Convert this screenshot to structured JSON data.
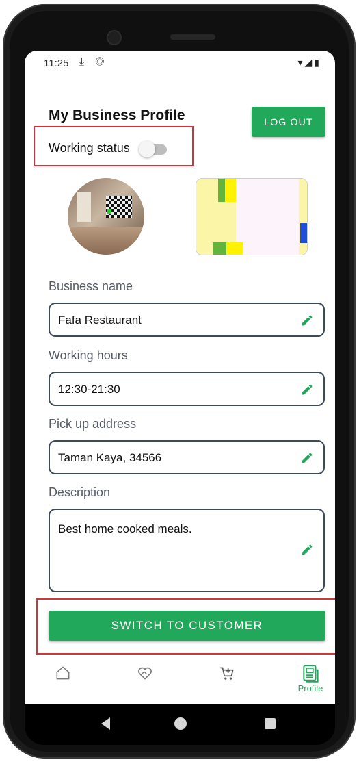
{
  "status_bar": {
    "time": "11:25",
    "left_icons": "⤓ ◎",
    "right_icons": "▾◢▮"
  },
  "header": {
    "title": "My Business Profile",
    "logout_label": "LOG OUT"
  },
  "working_status": {
    "label": "Working status",
    "on": false
  },
  "fields": [
    {
      "label": "Business name",
      "value": "Fafa Restaurant"
    },
    {
      "label": "Working hours",
      "value": "12:30-21:30"
    },
    {
      "label": "Pick up address",
      "value": "Taman Kaya, 34566"
    },
    {
      "label": "Description",
      "value": "Best home cooked meals."
    }
  ],
  "switch_button_label": "SWITCH TO CUSTOMER",
  "bottom_nav": {
    "items": [
      {
        "icon": "home-icon"
      },
      {
        "icon": "heart-handshake-icon"
      },
      {
        "icon": "cart-add-icon"
      },
      {
        "icon": "profile-icon",
        "label": "Profile",
        "active": true
      }
    ]
  },
  "colors": {
    "accent": "#22a85a",
    "highlight_border": "#d6323a",
    "field_border": "#3d4a5a"
  }
}
